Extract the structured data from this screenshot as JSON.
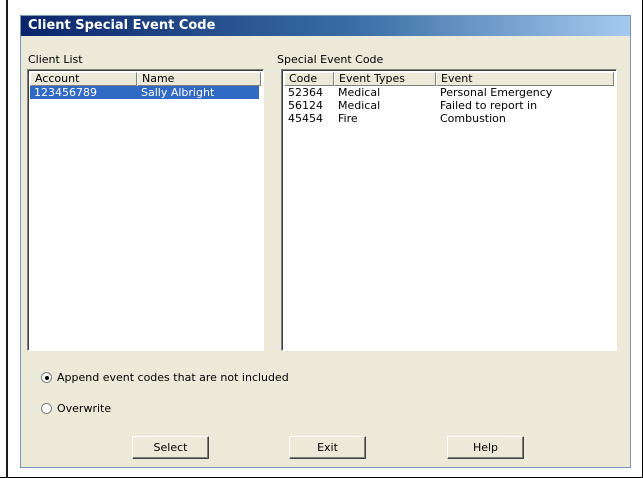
{
  "window": {
    "title": "Client Special Event Code"
  },
  "client_list": {
    "label": "Client List",
    "columns": [
      "Account",
      "Name"
    ],
    "rows": [
      {
        "account": "123456789",
        "name": "Sally Albright",
        "selected": true
      }
    ]
  },
  "event_code": {
    "label": "Special Event Code",
    "columns": [
      "Code",
      "Event Types",
      "Event"
    ],
    "rows": [
      {
        "code": "52364",
        "type": "Medical",
        "event": "Personal Emergency"
      },
      {
        "code": "56124",
        "type": "Medical",
        "event": "Failed to report in"
      },
      {
        "code": "45454",
        "type": "Fire",
        "event": "Combustion"
      }
    ]
  },
  "options": {
    "append_label": "Append event codes that are not included",
    "append_checked": true,
    "overwrite_label": "Overwrite",
    "overwrite_checked": false
  },
  "buttons": {
    "select": "Select",
    "exit": "Exit",
    "help": "Help"
  },
  "colors": {
    "selection": "#316ac5",
    "face": "#ece9d8",
    "title_start": "#0a246a",
    "title_end": "#a6caf0"
  }
}
